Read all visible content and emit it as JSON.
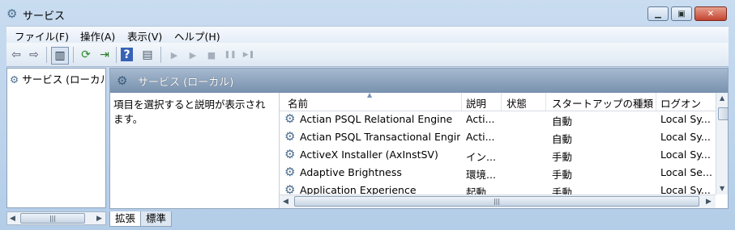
{
  "window": {
    "title": "サービス",
    "app_icon": "gear-icon"
  },
  "caption_buttons": {
    "minimize": "▁",
    "maximize": "▣",
    "close": "✕"
  },
  "menu": [
    "ファイル(F)",
    "操作(A)",
    "表示(V)",
    "ヘルプ(H)"
  ],
  "toolbar": {
    "back": "⇦",
    "forward": "⇨",
    "show_hide_tree": "▥",
    "refresh": "⟳",
    "export": "⇥",
    "help": "?",
    "properties": "▤",
    "start": "▶",
    "start_paused": "▶",
    "stop": "■",
    "pause": "❚❚",
    "resume": "▶❚"
  },
  "tree": {
    "item": "サービス (ローカル)"
  },
  "panel": {
    "title": "サービス (ローカル)",
    "description": "項目を選択すると説明が表示されます。"
  },
  "list": {
    "columns": [
      "名前",
      "説明",
      "状態",
      "スタートアップの種類",
      "ログオン"
    ],
    "rows": [
      {
        "name": "Actian PSQL Relational Engine",
        "desc": "Acti...",
        "status": "",
        "startup": "自動",
        "logon": "Local Sy..."
      },
      {
        "name": "Actian PSQL Transactional Engine",
        "desc": "Acti...",
        "status": "",
        "startup": "自動",
        "logon": "Local Sy..."
      },
      {
        "name": "ActiveX Installer (AxInstSV)",
        "desc": "イン...",
        "status": "",
        "startup": "手動",
        "logon": "Local Sy..."
      },
      {
        "name": "Adaptive Brightness",
        "desc": "環境...",
        "status": "",
        "startup": "手動",
        "logon": "Local Se..."
      },
      {
        "name": "Application Experience",
        "desc": "起動...",
        "status": "",
        "startup": "手動",
        "logon": "Local Sy..."
      }
    ]
  },
  "scroll": {
    "grip": "|||"
  },
  "tabs": [
    "拡張",
    "標準"
  ],
  "colors": {
    "header_gradient_top": "#a6b9cf",
    "header_gradient_bottom": "#7891ae",
    "close_button": "#c24430"
  }
}
